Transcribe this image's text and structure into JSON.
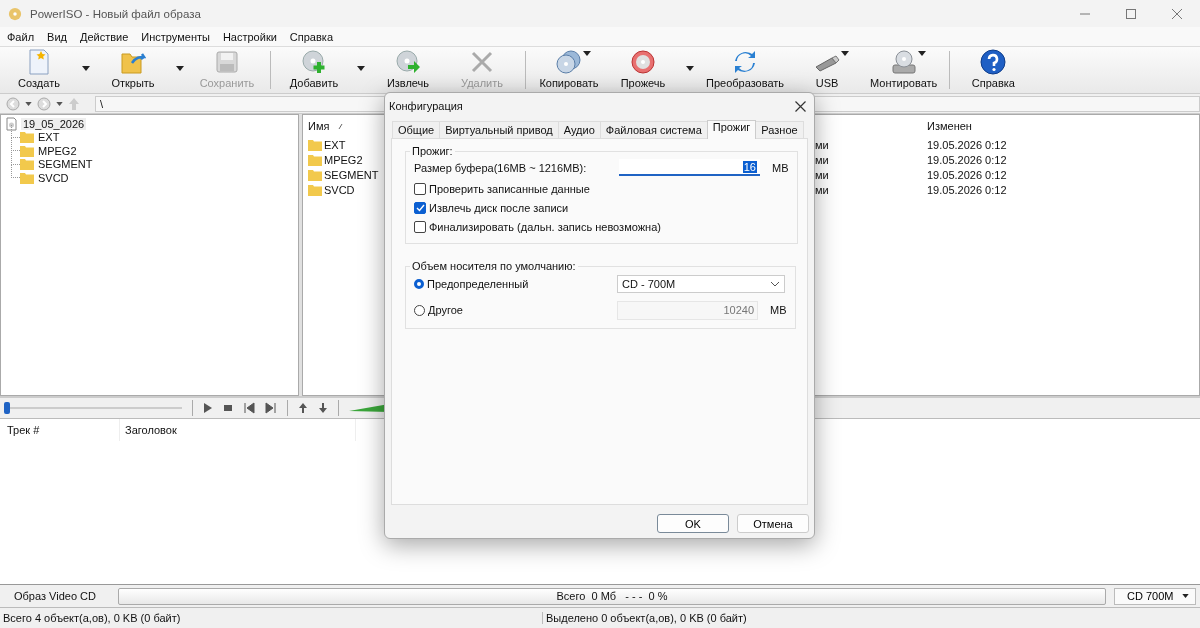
{
  "window": {
    "title": "PowerISO - Новый файл образа"
  },
  "menu": [
    "Файл",
    "Вид",
    "Действие",
    "Инструменты",
    "Настройки",
    "Справка"
  ],
  "toolbar": [
    [
      {
        "label": "Создать",
        "disabled": false,
        "kind": "split"
      },
      {
        "label": "Открыть",
        "disabled": false,
        "kind": "split"
      },
      {
        "label": "Сохранить",
        "disabled": true,
        "kind": "plain"
      }
    ],
    [
      {
        "label": "Добавить",
        "disabled": false,
        "kind": "split"
      },
      {
        "label": "Извлечь",
        "disabled": false,
        "kind": "plain"
      },
      {
        "label": "Удалить",
        "disabled": true,
        "kind": "plain"
      }
    ],
    [
      {
        "label": "Копировать",
        "disabled": false,
        "kind": "menu"
      },
      {
        "label": "Прожечь",
        "disabled": false,
        "kind": "split"
      },
      {
        "label": "Преобразовать",
        "disabled": false,
        "kind": "plain"
      },
      {
        "label": "USB",
        "disabled": false,
        "kind": "menu"
      },
      {
        "label": "Монтировать",
        "disabled": false,
        "kind": "menu"
      }
    ],
    [
      {
        "label": "Справка",
        "disabled": false,
        "kind": "plain"
      }
    ]
  ],
  "address": {
    "path": "\\"
  },
  "tree": {
    "label": "19_05_2026",
    "selected": true,
    "children": [
      {
        "label": "EXT",
        "selected": false
      },
      {
        "label": "MPEG2",
        "selected": false
      },
      {
        "label": "SEGMENT",
        "selected": false
      },
      {
        "label": "SVCD",
        "selected": false
      }
    ]
  },
  "file_list": {
    "columns": {
      "name": {
        "label": "Имя",
        "sorted": true
      },
      "modified": {
        "label": "Изменен"
      }
    },
    "rows": [
      {
        "name": "EXT",
        "column_2": "ми",
        "modified": "19.05.2026 0:12"
      },
      {
        "name": "MPEG2",
        "column_2": "ми",
        "modified": "19.05.2026 0:12"
      },
      {
        "name": "SEGMENT",
        "column_2": "ми",
        "modified": "19.05.2026 0:12"
      },
      {
        "name": "SVCD",
        "column_2": "ми",
        "modified": "19.05.2026 0:12"
      }
    ]
  },
  "player": {
    "level": 0
  },
  "tracks": {
    "columns": [
      "Трек #",
      "Заголовок"
    ]
  },
  "status": {
    "image_type": "Образ Video CD",
    "usage": "Всего  0 Мб   - - -  0 %",
    "media": "CD 700M",
    "total": "Всего 4 объект(а,ов), 0 KB (0 байт)",
    "selected": "Выделено 0 объект(а,ов), 0 KB (0 байт)"
  },
  "dialog": {
    "title": "Конфигурация",
    "tabs": [
      {
        "label": "Общие",
        "selected": false
      },
      {
        "label": "Виртуальный привод",
        "selected": false
      },
      {
        "label": "Аудио",
        "selected": false
      },
      {
        "label": "Файловая система",
        "selected": false
      },
      {
        "label": "Прожиг",
        "selected": true
      },
      {
        "label": "Разное",
        "selected": false
      }
    ],
    "burn_group": {
      "title": "Прожиг:",
      "buffer_label": "Размер буфера(16MB ~ 1216MB):",
      "buffer_value": "16",
      "buffer_value_highlighted": true,
      "buffer_unit": "MB",
      "options": [
        {
          "label": "Проверить записанные данные",
          "checked": false
        },
        {
          "label": "Извлечь диск после записи",
          "checked": true
        },
        {
          "label": "Финализировать (дальн. запись невозможна)",
          "checked": false
        }
      ]
    },
    "media_group": {
      "title": "Объем носителя по умолчанию:",
      "choices": [
        {
          "label": "Предопределенный",
          "selected": true,
          "kind": "dropdown",
          "value": "CD - 700M"
        },
        {
          "label": "Другое",
          "selected": false,
          "kind": "number",
          "value": "10240",
          "unit": "MB"
        }
      ]
    },
    "buttons": [
      {
        "label": "OK",
        "default": true
      },
      {
        "label": "Отмена",
        "default": false
      }
    ]
  }
}
